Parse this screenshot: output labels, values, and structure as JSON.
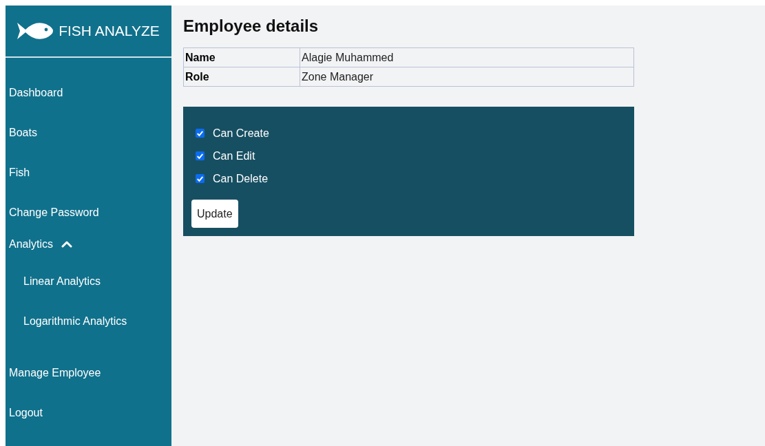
{
  "brand": {
    "title": "FISH ANALYZE"
  },
  "sidebar": {
    "items": [
      {
        "label": "Dashboard"
      },
      {
        "label": "Boats"
      },
      {
        "label": "Fish"
      },
      {
        "label": "Change Password"
      },
      {
        "label": "Analytics",
        "expanded": true,
        "children": [
          {
            "label": "Linear Analytics"
          },
          {
            "label": "Logarithmic Analytics"
          }
        ]
      },
      {
        "label": "Manage Employee"
      },
      {
        "label": "Logout"
      }
    ]
  },
  "page": {
    "title": "Employee details"
  },
  "details": [
    {
      "label": "Name",
      "value": "Alagie Muhammed"
    },
    {
      "label": "Role",
      "value": "Zone Manager"
    }
  ],
  "permissions": [
    {
      "label": "Can Create",
      "checked": true
    },
    {
      "label": "Can Edit",
      "checked": true
    },
    {
      "label": "Can Delete",
      "checked": true
    }
  ],
  "update_button": "Update"
}
